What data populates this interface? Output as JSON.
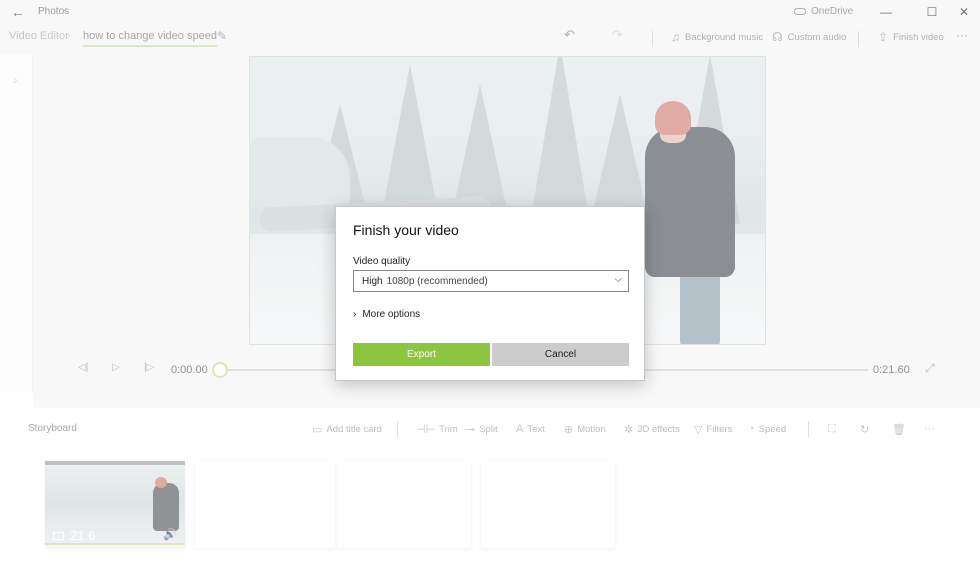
{
  "window": {
    "app_title": "Photos",
    "account_label": "OneDrive",
    "controls": {
      "minimize": "—",
      "maximize": "☐",
      "close": "✕"
    }
  },
  "header": {
    "breadcrumb_root": "Video Editor",
    "breadcrumb_separator": "›",
    "project_name": "how to change video speed",
    "commands": {
      "undo_icon": "↶",
      "redo_icon": "↷",
      "background_music": "Background music",
      "custom_audio": "Custom audio",
      "finish_video": "Finish video",
      "more": "···"
    }
  },
  "left_panel": {
    "expand_icon": "›"
  },
  "player": {
    "current_time": "0:00.00",
    "total_time": "0:21.60",
    "progress": 0
  },
  "storyboard": {
    "title": "Storyboard",
    "tools": [
      {
        "label": "Add title card",
        "icon": "▭"
      },
      {
        "label": "Trim",
        "icon": "⊣⊢"
      },
      {
        "label": "Split",
        "icon": "⊸"
      },
      {
        "label": "Text",
        "icon": "A"
      },
      {
        "label": "Motion",
        "icon": "⊕"
      },
      {
        "label": "3D effects",
        "icon": "✲"
      },
      {
        "label": "Filters",
        "icon": "▽"
      },
      {
        "label": "Speed",
        "icon": "◔"
      }
    ],
    "cards": [
      {
        "duration": "21.6",
        "has_audio": true
      }
    ]
  },
  "dialog": {
    "title": "Finish your video",
    "quality_label": "Video quality",
    "quality_value": "High",
    "quality_detail": "1080p (recommended)",
    "more_options": "More options",
    "export_label": "Export",
    "cancel_label": "Cancel"
  },
  "colors": {
    "accent": "#8cc63f",
    "accent_light": "#c6df98"
  }
}
